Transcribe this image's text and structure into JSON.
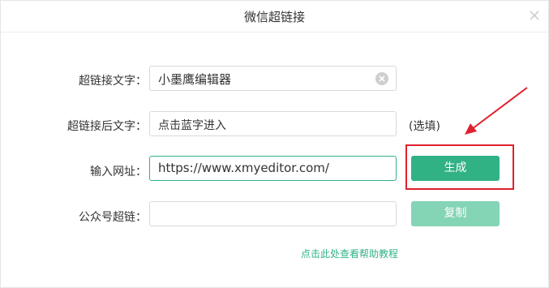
{
  "dialog": {
    "title": "微信超链接"
  },
  "form": {
    "link_text": {
      "label": "超链接文字：",
      "value": "小墨鹰编辑器"
    },
    "after_text": {
      "label": "超链接后文字：",
      "value": "点击蓝字进入",
      "optional_hint": "(选填)"
    },
    "url": {
      "label": "输入网址：",
      "value": "https://www.xmyeditor.com/"
    },
    "mp_link": {
      "label": "公众号超链：",
      "value": ""
    }
  },
  "buttons": {
    "generate": "生成",
    "copy": "复制"
  },
  "help_link": "点击此处查看帮助教程",
  "colors": {
    "accent": "#31b285",
    "accent_disabled": "#84d4b6",
    "annotation_red": "#e0202e"
  }
}
